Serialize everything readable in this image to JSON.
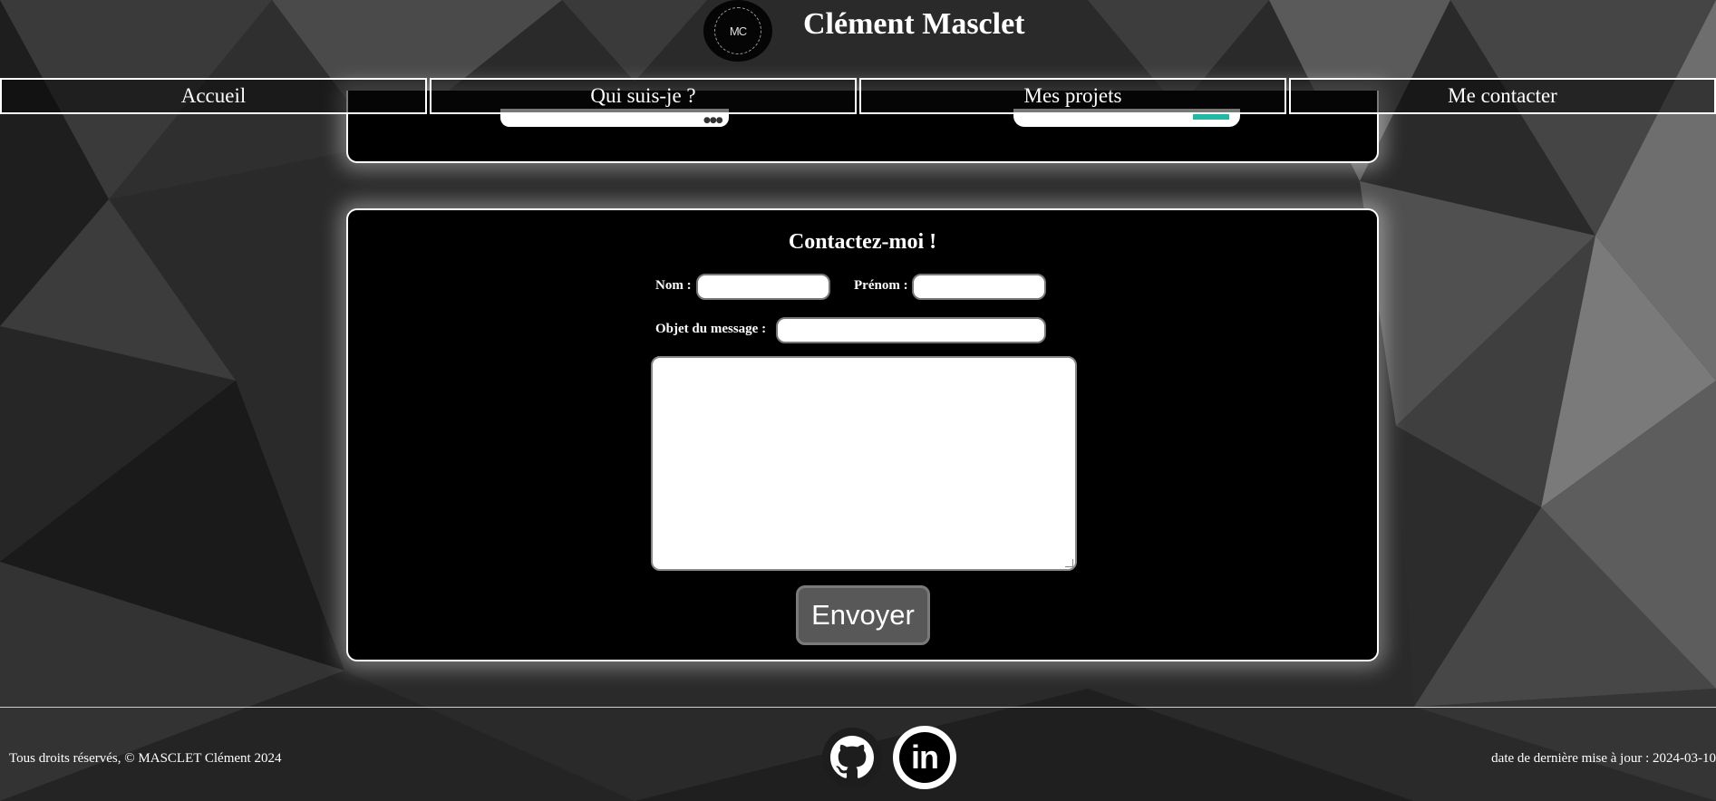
{
  "header": {
    "logo_text": "MC",
    "site_title": "Clément Masclet"
  },
  "nav": {
    "items": [
      {
        "label": "Accueil"
      },
      {
        "label": "Qui suis-je ?"
      },
      {
        "label": "Mes projets"
      },
      {
        "label": "Me contacter"
      }
    ]
  },
  "contact": {
    "title": "Contactez-moi !",
    "nom_label": "Nom :",
    "prenom_label": "Prénom :",
    "objet_label": "Objet du message :",
    "nom_value": "",
    "prenom_value": "",
    "objet_value": "",
    "message_value": "",
    "submit_label": "Envoyer"
  },
  "footer": {
    "copyright": "Tous droits réservés, © MASCLET Clément 2024",
    "last_update": "date de dernière mise à jour : 2024-03-10",
    "github_icon": "github-icon",
    "linkedin_icon": "linkedin-icon",
    "linkedin_text": "in"
  },
  "colors": {
    "card_bg": "#000000",
    "button_bg": "#585858",
    "accent_teal": "#21b8a6"
  }
}
